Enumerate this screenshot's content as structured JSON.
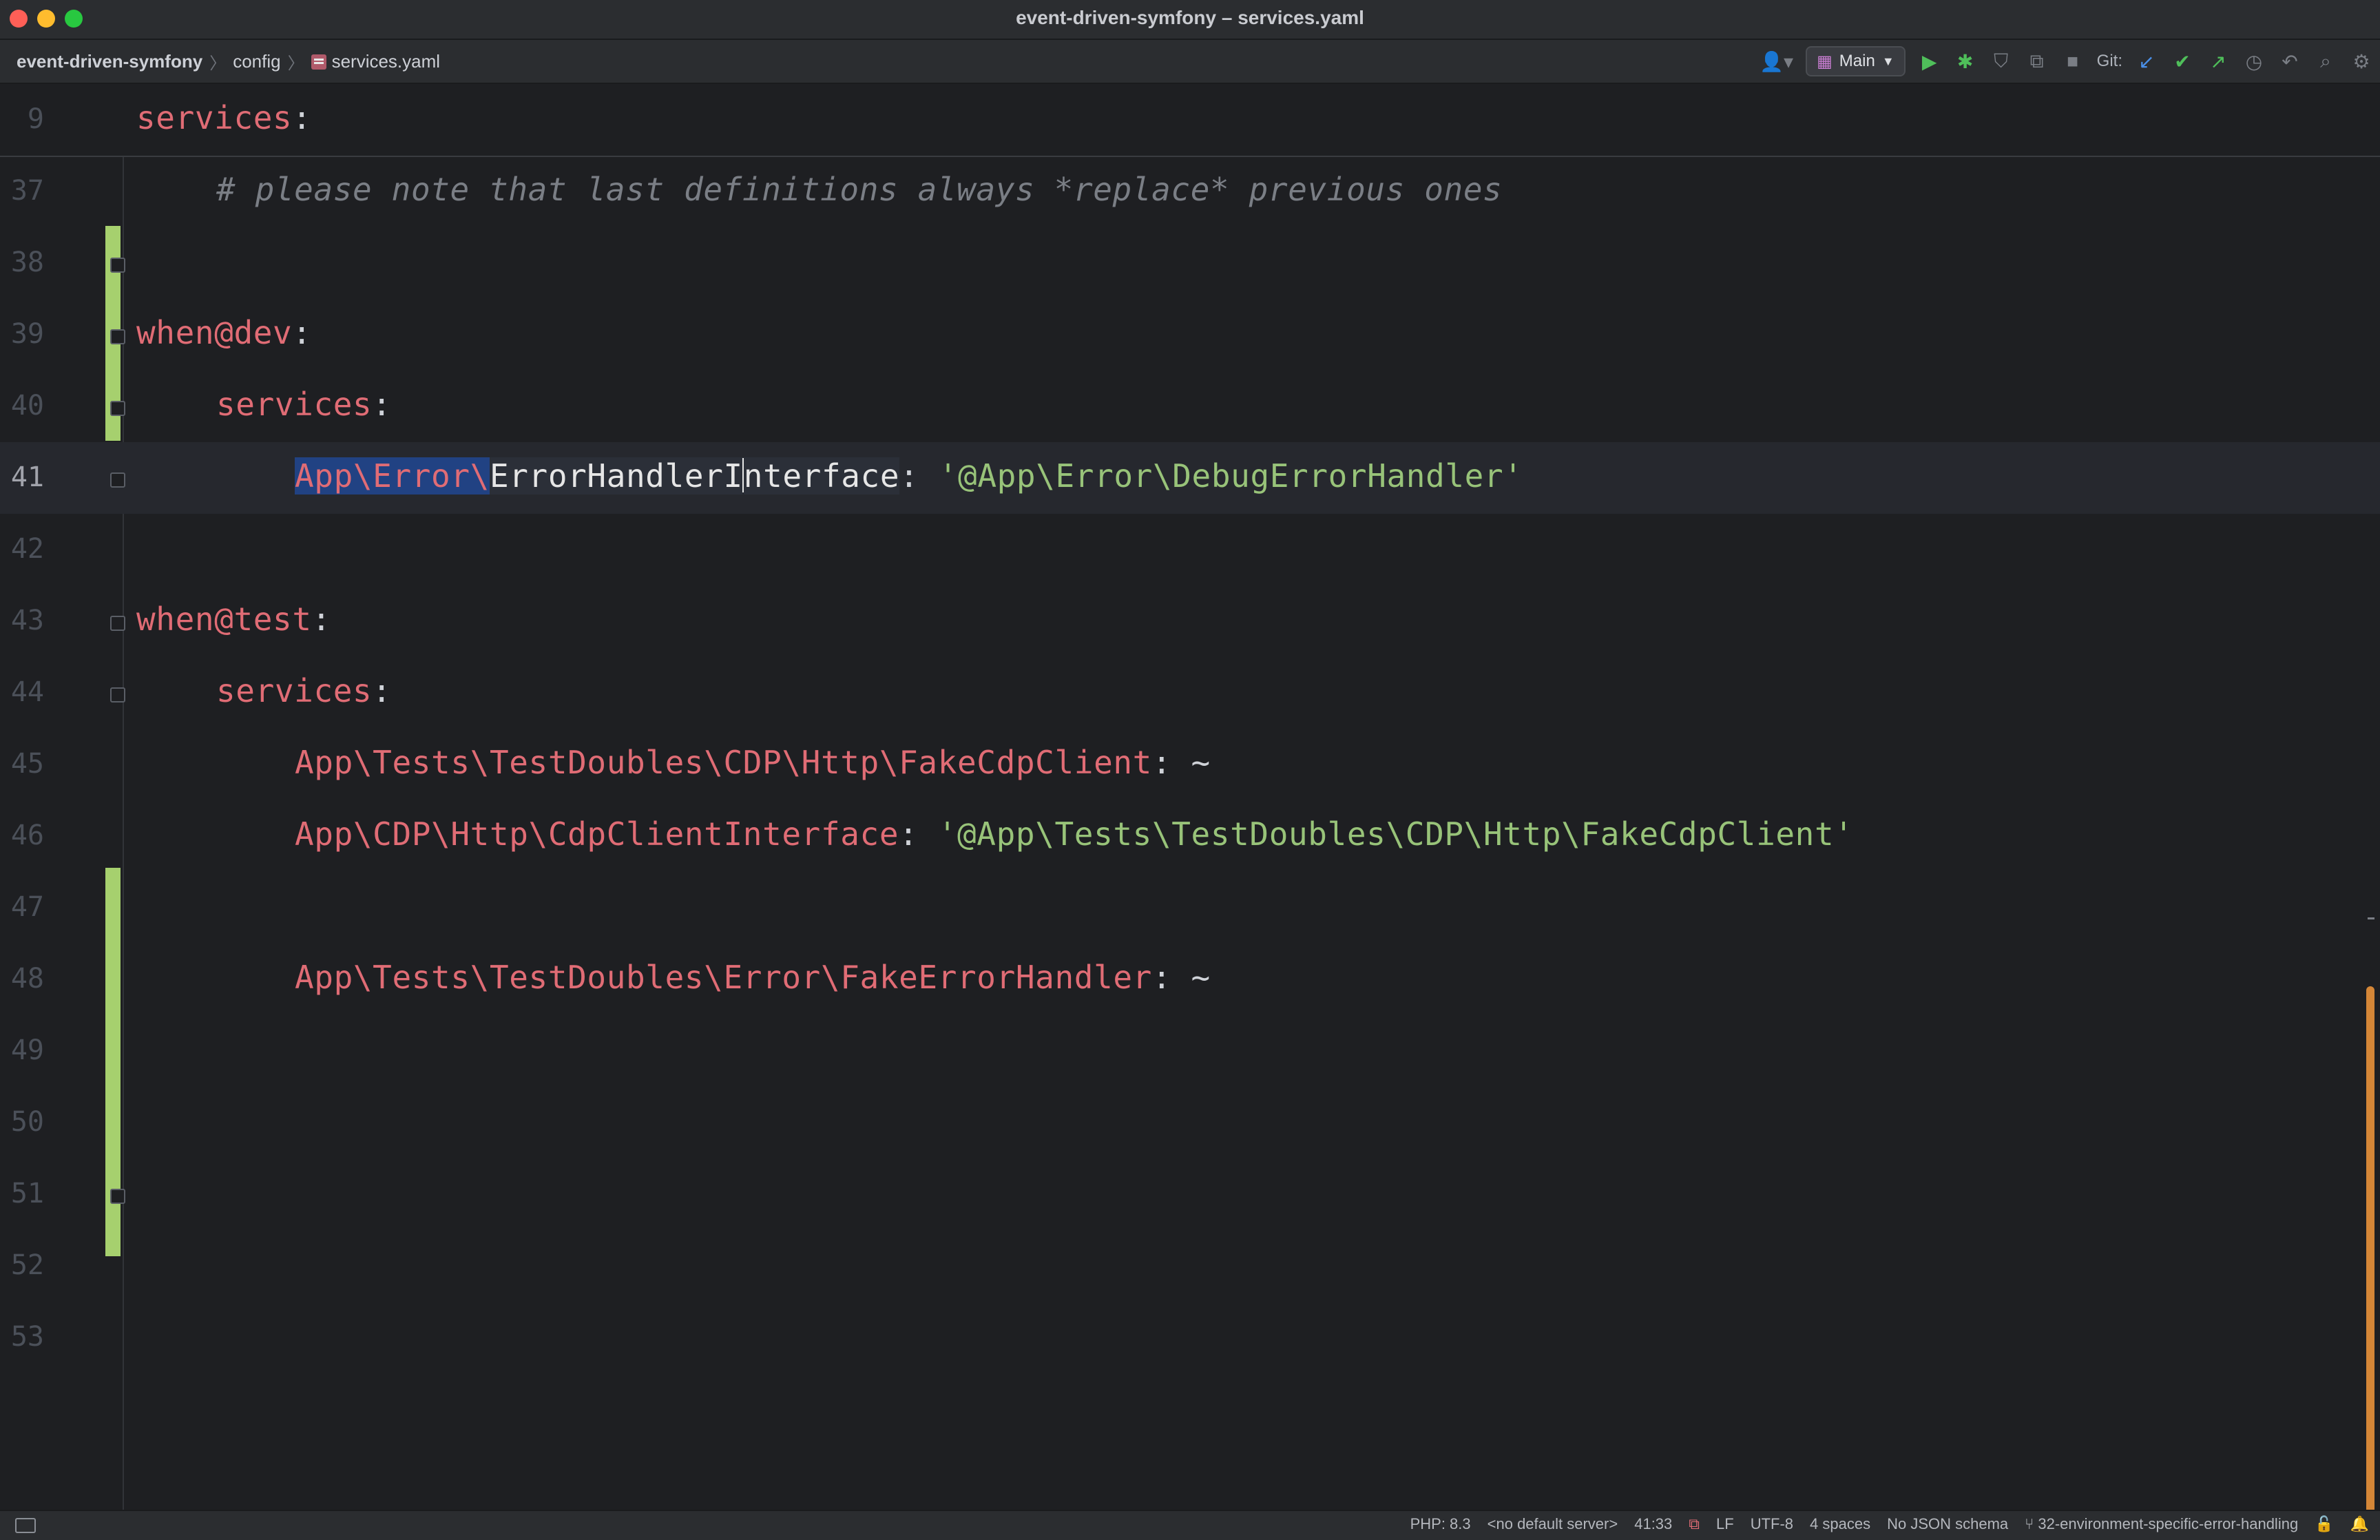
{
  "window": {
    "title": "event-driven-symfony – services.yaml"
  },
  "breadcrumbs": [
    {
      "label": "event-driven-symfony"
    },
    {
      "label": "config"
    },
    {
      "label": "services.yaml"
    }
  ],
  "toolbar": {
    "run_config": "Main",
    "git_label": "Git:"
  },
  "editor": {
    "sticky_line": {
      "number": "9",
      "key": "services",
      "colon": ":"
    },
    "lines": [
      {
        "number": "37",
        "comment": "# please note that last definitions always *replace* previous ones"
      },
      {
        "number": "38"
      },
      {
        "number": "39",
        "key": "when@dev",
        "colon": ":"
      },
      {
        "number": "40",
        "key": "services",
        "colon": ":"
      },
      {
        "number": "41",
        "key_sel": "App\\Error\\",
        "key_rest_a": "ErrorHandlerI",
        "key_rest_b": "nterface",
        "colon": ": ",
        "value": "'@App\\Error\\DebugErrorHandler'"
      },
      {
        "number": "42"
      },
      {
        "number": "43",
        "key": "when@test",
        "colon": ":"
      },
      {
        "number": "44",
        "key": "services",
        "colon": ":"
      },
      {
        "number": "45",
        "key": "App\\Tests\\TestDoubles\\CDP\\Http\\FakeCdpClient",
        "colon": ": ~"
      },
      {
        "number": "46",
        "key": "App\\CDP\\Http\\CdpClientInterface",
        "colon": ": ",
        "value": "'@App\\Tests\\TestDoubles\\CDP\\Http\\FakeCdpClient'"
      },
      {
        "number": "47"
      },
      {
        "number": "48",
        "key": "App\\Tests\\TestDoubles\\Error\\FakeErrorHandler",
        "colon": ": ~"
      },
      {
        "number": "49"
      },
      {
        "number": "50"
      },
      {
        "number": "51"
      },
      {
        "number": "52"
      },
      {
        "number": "53"
      }
    ]
  },
  "status": {
    "php": "PHP: 8.3",
    "server": "<no default server>",
    "position": "41:33",
    "line_ending": "LF",
    "encoding": "UTF-8",
    "indent": "4 spaces",
    "schema": "No JSON schema",
    "branch": "32-environment-specific-error-handling"
  },
  "colors": {
    "background": "#1e1f22",
    "key": "#e06c75",
    "string": "#98c379",
    "comment": "#7a7e85",
    "vcs_added": "#a6d06e",
    "selection": "#214283"
  },
  "icons": [
    "user-icon",
    "run-icon",
    "debug-icon",
    "coverage-icon",
    "profile-icon",
    "stop-icon",
    "git-update-icon",
    "git-commit-icon",
    "git-push-icon",
    "history-icon",
    "rollback-icon",
    "search-icon",
    "settings-icon",
    "branch-icon",
    "lock-icon",
    "bell-icon"
  ]
}
